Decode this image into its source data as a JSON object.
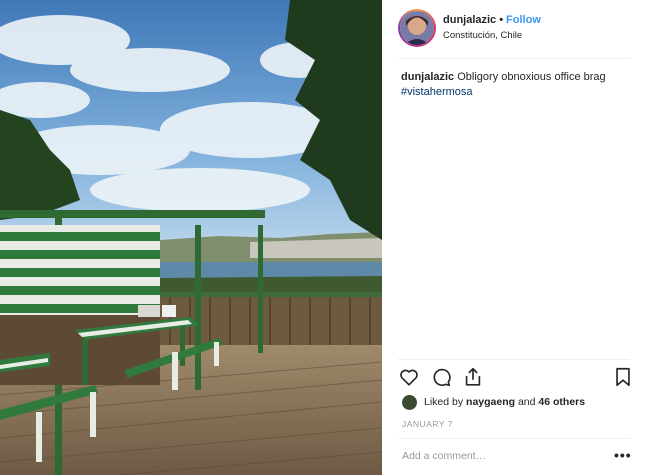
{
  "post": {
    "username": "dunjalazic",
    "separator": "•",
    "follow_label": "Follow",
    "location": "Constitución, Chile",
    "caption_user": "dunjalazic",
    "caption_text": "Obligory obnoxious office brag",
    "hashtag": "#vistahermosa",
    "likes_prefix": "Liked by",
    "likes_user": "naygaeng",
    "likes_mid": "and",
    "likes_others": "46 others",
    "date": "JANUARY 7",
    "comment_placeholder": "Add a comment…",
    "more_label": "•••"
  },
  "icons": {
    "like": "heart-icon",
    "comment": "comment-bubble-icon",
    "share": "share-icon",
    "save": "bookmark-icon",
    "more": "more-options-icon"
  },
  "colors": {
    "follow": "#3897f0",
    "hashtag": "#003569",
    "muted": "#999999",
    "text": "#262626"
  }
}
